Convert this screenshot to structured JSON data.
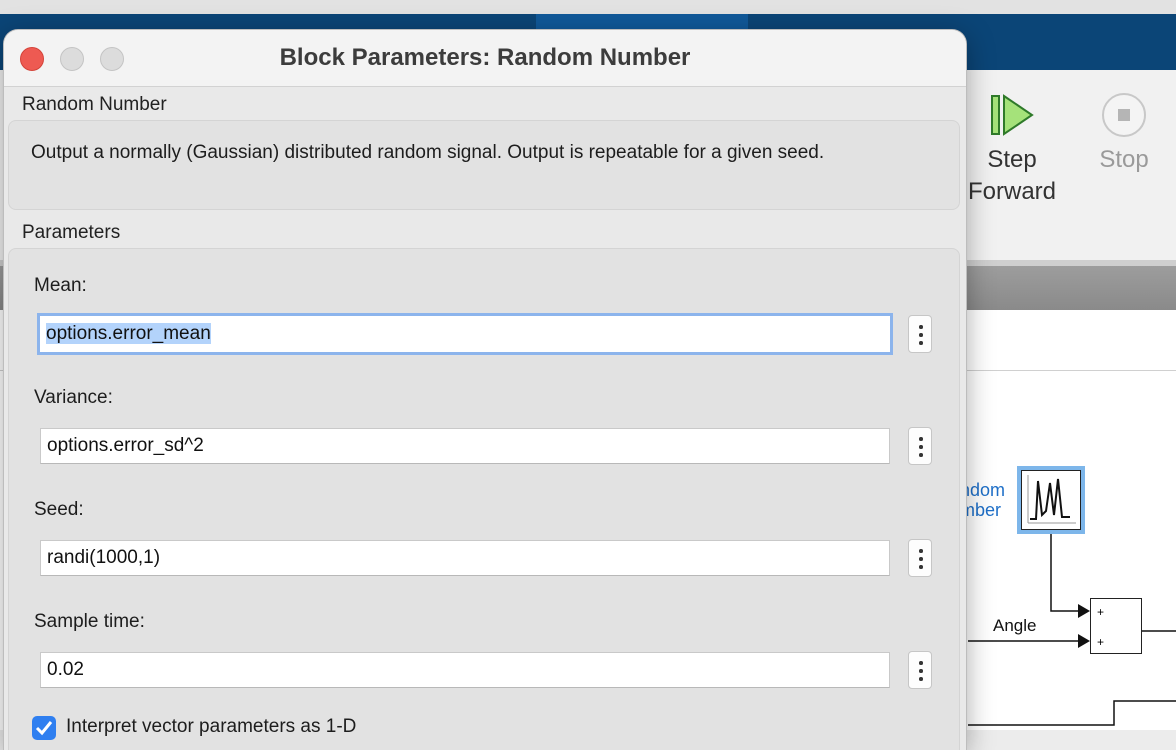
{
  "background": {
    "toolstrip": {
      "step_forward_label_1": "Step",
      "step_forward_label_2": "Forward",
      "stop_label": "Stop"
    },
    "model": {
      "random_number_label_1": "ndom",
      "random_number_label_2": "mber",
      "sum_signs": [
        "+",
        "+"
      ],
      "signal_label": "Angle"
    }
  },
  "dialog": {
    "title": "Block Parameters: Random Number",
    "block_name": "Random Number",
    "description": "Output a normally (Gaussian) distributed random signal.  Output is repeatable for a given seed.",
    "parameters_title": "Parameters",
    "fields": [
      {
        "label": "Mean:",
        "value": "options.error_mean",
        "selected": true
      },
      {
        "label": "Variance:",
        "value": "options.error_sd^2"
      },
      {
        "label": "Seed:",
        "value": "randi(1000,1)"
      },
      {
        "label": "Sample time:",
        "value": "0.02"
      }
    ],
    "checkbox": {
      "label": "Interpret vector parameters as 1-D",
      "checked": true
    }
  },
  "colors": {
    "titlebar_blue": "#0b4577",
    "selection": "#b3d3fb",
    "focus_ring": "#8cb4ec",
    "checkbox_blue": "#2f7ff0",
    "block_label_blue": "#1e6fc8"
  }
}
